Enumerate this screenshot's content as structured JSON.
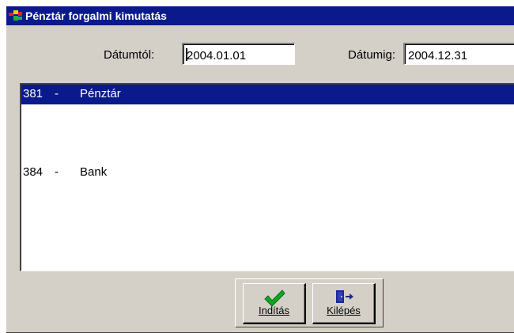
{
  "window": {
    "title": "Pénztár forgalmi kimutatás",
    "icon": "traffic-light-app-icon"
  },
  "dates": {
    "from_label": "Dátumtól:",
    "from_value": "2004.01.01",
    "to_label": "Dátumig:",
    "to_value": "2004.12.31"
  },
  "accounts": [
    {
      "code": "381",
      "dash": "-",
      "name": "Pénztár",
      "selected": true
    },
    {
      "code": "384",
      "dash": "-",
      "name": "Bank",
      "selected": false
    }
  ],
  "buttons": {
    "start_label": "Indítás",
    "start_icon": "checkmark-icon",
    "exit_label": "Kilépés",
    "exit_icon": "exit-door-icon"
  },
  "colors": {
    "titlebar": "#0a1a8c",
    "selection": "#0a1a8c",
    "face": "#d4d0c8",
    "check": "#0fa81f"
  }
}
